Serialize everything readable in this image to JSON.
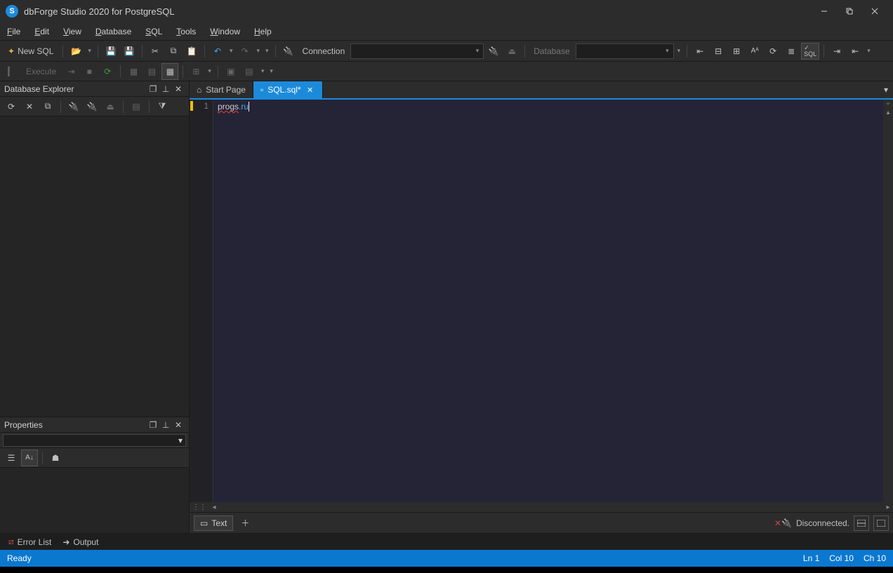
{
  "titlebar": {
    "app_icon_letter": "S",
    "title": "dbForge Studio 2020 for PostgreSQL"
  },
  "menu": {
    "file": "File",
    "edit": "Edit",
    "view": "View",
    "database": "Database",
    "sql": "SQL",
    "tools": "Tools",
    "window": "Window",
    "help": "Help"
  },
  "toolbar1": {
    "new_sql": "New SQL",
    "connection_label": "Connection",
    "connection_value": "",
    "database_label": "Database",
    "database_value": "",
    "sql_btn": "SQL"
  },
  "toolbar2": {
    "execute": "Execute"
  },
  "panels": {
    "db_explorer": {
      "title": "Database Explorer"
    },
    "properties": {
      "title": "Properties"
    }
  },
  "tabs": {
    "start_page": "Start Page",
    "sql_file": "SQL.sql*"
  },
  "editor": {
    "line_number": "1",
    "tok1": "progs",
    "tok2": ".",
    "tok3": "ru"
  },
  "editor_footer": {
    "text_view": "Text",
    "connection_status": "Disconnected."
  },
  "bottom_tabs": {
    "error_list": "Error List",
    "output": "Output"
  },
  "statusbar": {
    "ready": "Ready",
    "ln": "Ln 1",
    "col": "Col 10",
    "ch": "Ch 10"
  }
}
